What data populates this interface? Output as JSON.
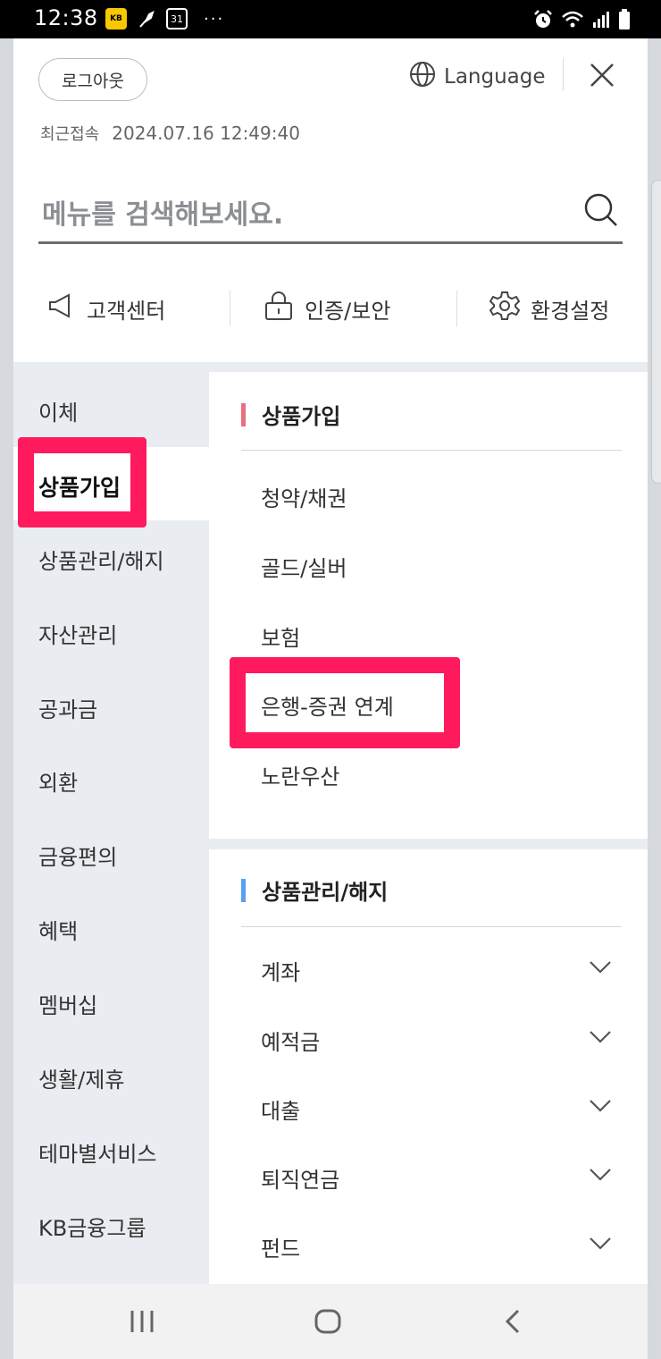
{
  "status_bar": {
    "time": "12:38",
    "kb_badge": "KB",
    "calendar_day": "31",
    "more": "···"
  },
  "header": {
    "logout_label": "로그아웃",
    "language_label": "Language",
    "last_login_label": "최근접속",
    "last_login_value": "2024.07.16 12:49:40"
  },
  "search": {
    "placeholder": "메뉴를 검색해보세요."
  },
  "quick_links": [
    {
      "label": "고객센터",
      "icon": "megaphone-icon"
    },
    {
      "label": "인증/보안",
      "icon": "lock-icon"
    },
    {
      "label": "환경설정",
      "icon": "gear-icon"
    }
  ],
  "left_menu": {
    "active": "상품가입",
    "items": [
      "이체",
      "상품가입",
      "상품관리/해지",
      "자산관리",
      "공과금",
      "외환",
      "금융편의",
      "혜택",
      "멤버십",
      "생활/제휴",
      "테마별서비스",
      "KB금융그룹"
    ]
  },
  "sections": [
    {
      "title": "상품가입",
      "accent": "#e8707c",
      "items": [
        "청약/채권",
        "골드/실버",
        "보험",
        "은행-증권 연계",
        "노란우산"
      ]
    },
    {
      "title": "상품관리/해지",
      "accent": "#5aa0f0",
      "items": [
        "계좌",
        "예적금",
        "대출",
        "퇴직연금",
        "펀드"
      ]
    }
  ],
  "highlight_color": "#ff1a5e"
}
